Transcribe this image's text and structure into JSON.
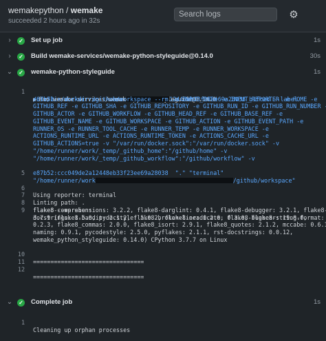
{
  "header": {
    "owner": "wemakepython",
    "separator": " / ",
    "repo": "wemake",
    "status": "succeeded 2 hours ago in 32s",
    "search_placeholder": "Search logs"
  },
  "steps": [
    {
      "label": "Set up job",
      "duration": "1s",
      "expanded": false
    },
    {
      "label": "Build wemake-services/wemake-python-styleguide@0.14.0",
      "duration": "30s",
      "expanded": false
    },
    {
      "label": "wemake-python-styleguide",
      "duration": "1s",
      "expanded": true
    },
    {
      "label": "Complete job",
      "duration": "1s",
      "expanded": true
    }
  ],
  "log": {
    "l1": "Run wemake-services/wemake-python-styleguide@0.14.0",
    "l2a": "/usr/bin/docker run --name ",
    "l2b": "12448eb33f23ee69a28038_b1fced --label",
    "l3": "e87b52 --workdir /github/workspace --rm -e INPUT_PATH -e INPUT_REPORTER -e HOME -e",
    "l4": "GITHUB_REF -e GITHUB_SHA -e GITHUB_REPOSITORY -e GITHUB_RUN_ID -e GITHUB_RUN_NUMBER -e",
    "l5": "GITHUB_ACTOR -e GITHUB_WORKFLOW -e GITHUB_HEAD_REF -e GITHUB_BASE_REF -e",
    "l6": "GITHUB_EVENT_NAME -e GITHUB_WORKSPACE -e GITHUB_ACTION -e GITHUB_EVENT_PATH -e",
    "l7": "RUNNER_OS -e RUNNER_TOOL_CACHE -e RUNNER_TEMP -e RUNNER_WORKSPACE -e",
    "l8": "ACTIONS_RUNTIME_URL -e ACTIONS_RUNTIME_TOKEN -e ACTIONS_CACHE_URL -e",
    "l9": "GITHUB_ACTIONS=true -v \"/var/run/docker.sock\":\"/var/run/docker.sock\" -v",
    "l10": "\"/home/runner/work/_temp/_github_home\":\"/github/home\" -v",
    "l11": "\"/home/runner/work/_temp/_github_workflow\":\"/github/workflow\" -v",
    "l12a": "\"/home/runner/work",
    "l12b": "/github/workspace\"",
    "l13": "e87b52:ccc049de2a12448eb33f23ee69a28038  \".\" \"terminal\"",
    "l6t": "Using reporter: terminal",
    "l7t": "Linting path: .",
    "l8t": "flake8 --version:",
    "l9t": "3.7.9 (flake8-bandit: 2.1.2, flake8-broken-line: 0.2.0, flake8-bugbear: 19.8.0,",
    "l9b": "flake8-comprehensions: 3.2.2, flake8-darglint: 0.4.1, flake8-debugger: 3.2.1, flake8-",
    "l9c": "docstrings: 1.5.0, pydocstyle: 5.0.2, flake8-eradicate: 0.3.0, flake8-string-format:",
    "l9d": "0.2.3, flake8_commas: 2.0.0, flake8_isort: 2.9.1, flake8_quotes: 2.1.2, mccabe: 0.6.1,",
    "l9e": "naming: 0.9.1, pycodestyle: 2.5.0, pyflakes: 2.1.1, rst-docstrings: 0.0.12,",
    "l9f": "wemake_python_styleguide: 0.14.0) CPython 3.7.7 on Linux",
    "l10t": "================================",
    "l12t": "================================",
    "cleanup": "Cleaning up orphan processes"
  },
  "line_numbers": [
    "1",
    "5",
    "6",
    "7",
    "8",
    "9",
    "10",
    "11",
    "12",
    "1"
  ],
  "colors": {
    "success": "#28a745",
    "command": "#5aa8ff",
    "background": "#1f2428"
  }
}
